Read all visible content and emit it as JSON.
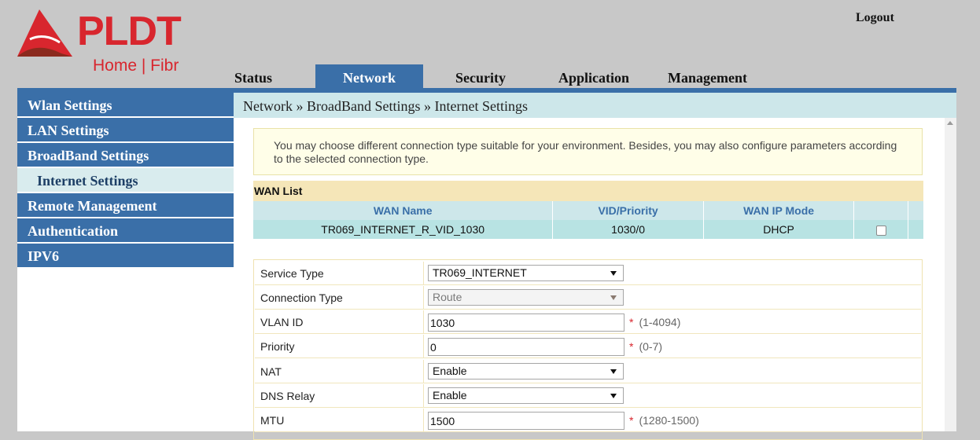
{
  "brand": {
    "name": "PLDT",
    "sub": "Home | Fibr",
    "colors": {
      "brand_red": "#d8262e",
      "nav_blue": "#3a6fa8",
      "breadcrumb_bg": "#cde7ea",
      "wan_row_bg": "#b8e3e3"
    }
  },
  "header": {
    "logout_label": "Logout"
  },
  "tabs": [
    {
      "label": "Status",
      "active": false
    },
    {
      "label": "Network",
      "active": true
    },
    {
      "label": "Security",
      "active": false
    },
    {
      "label": "Application",
      "active": false
    },
    {
      "label": "Management",
      "active": false
    }
  ],
  "sidebar": {
    "items": [
      {
        "label": "Wlan Settings"
      },
      {
        "label": "LAN Settings"
      },
      {
        "label": "BroadBand Settings"
      },
      {
        "label": "Internet Settings",
        "selected": true
      },
      {
        "label": "Remote Management"
      },
      {
        "label": "Authentication"
      },
      {
        "label": "IPV6"
      }
    ]
  },
  "breadcrumb": "Network » BroadBand Settings » Internet Settings",
  "info_text": "You may choose different connection type suitable for your environment. Besides, you may also configure parameters according to the selected connection type.",
  "wan_list": {
    "title": "WAN List",
    "columns": [
      "WAN Name",
      "VID/Priority",
      "WAN IP Mode",
      ""
    ],
    "rows": [
      {
        "name": "TR069_INTERNET_R_VID_1030",
        "vid_priority": "1030/0",
        "ip_mode": "DHCP",
        "checked": false
      }
    ]
  },
  "form": {
    "service_type": {
      "label": "Service Type",
      "value": "TR069_INTERNET"
    },
    "connection_type": {
      "label": "Connection Type",
      "value": "Route",
      "disabled": true
    },
    "vlan_id": {
      "label": "VLAN ID",
      "value": "1030",
      "required": "*",
      "hint": "(1-4094)"
    },
    "priority": {
      "label": "Priority",
      "value": "0",
      "required": "*",
      "hint": "(0-7)"
    },
    "nat": {
      "label": "NAT",
      "value": "Enable"
    },
    "dns_relay": {
      "label": "DNS Relay",
      "value": "Enable"
    },
    "mtu": {
      "label": "MTU",
      "value": "1500",
      "required": "*",
      "hint": "(1280-1500)"
    }
  }
}
